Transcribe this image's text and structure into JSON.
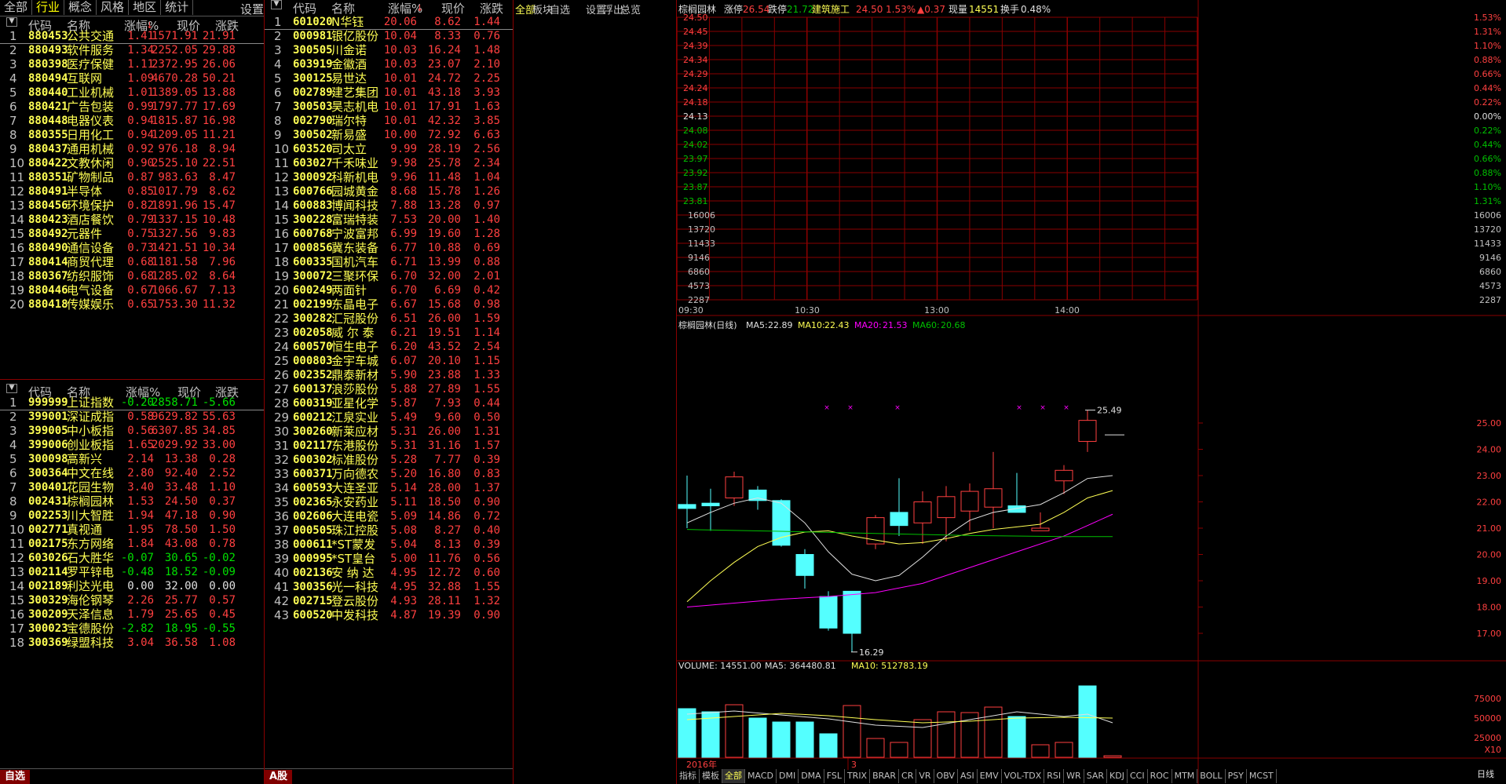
{
  "left_tabs": [
    "全部",
    "行业",
    "概念",
    "风格",
    "地区",
    "统计"
  ],
  "left_tabs_active": 1,
  "left_settings": "设置",
  "sector_table": {
    "headers": [
      "代码",
      "名称",
      "涨幅%",
      "现价",
      "涨跌"
    ],
    "rows": [
      [
        "1",
        "880453",
        "公共交通",
        "1.41",
        "1571.91",
        "21.91"
      ],
      [
        "2",
        "880493",
        "软件服务",
        "1.34",
        "2252.05",
        "29.88"
      ],
      [
        "3",
        "880398",
        "医疗保健",
        "1.11",
        "2372.95",
        "26.06"
      ],
      [
        "4",
        "880494",
        "互联网",
        "1.09",
        "4670.28",
        "50.21"
      ],
      [
        "5",
        "880440",
        "工业机械",
        "1.01",
        "1389.05",
        "13.88"
      ],
      [
        "6",
        "880421",
        "广告包装",
        "0.99",
        "1797.77",
        "17.69"
      ],
      [
        "7",
        "880448",
        "电器仪表",
        "0.94",
        "1815.87",
        "16.98"
      ],
      [
        "8",
        "880355",
        "日用化工",
        "0.94",
        "1209.05",
        "11.21"
      ],
      [
        "9",
        "880437",
        "通用机械",
        "0.92",
        "976.18",
        "8.94"
      ],
      [
        "10",
        "880422",
        "文教休闲",
        "0.90",
        "2525.10",
        "22.51"
      ],
      [
        "11",
        "880351",
        "矿物制品",
        "0.87",
        "983.63",
        "8.47"
      ],
      [
        "12",
        "880491",
        "半导体",
        "0.85",
        "1017.79",
        "8.62"
      ],
      [
        "13",
        "880456",
        "环境保护",
        "0.82",
        "1891.96",
        "15.47"
      ],
      [
        "14",
        "880423",
        "酒店餐饮",
        "0.79",
        "1337.15",
        "10.48"
      ],
      [
        "15",
        "880492",
        "元器件",
        "0.75",
        "1327.56",
        "9.83"
      ],
      [
        "16",
        "880490",
        "通信设备",
        "0.73",
        "1421.51",
        "10.34"
      ],
      [
        "17",
        "880414",
        "商贸代理",
        "0.68",
        "1181.58",
        "7.96"
      ],
      [
        "18",
        "880367",
        "纺织服饰",
        "0.68",
        "1285.02",
        "8.64"
      ],
      [
        "19",
        "880446",
        "电气设备",
        "0.67",
        "1066.67",
        "7.13"
      ],
      [
        "20",
        "880418",
        "传媒娱乐",
        "0.65",
        "1753.30",
        "11.32"
      ]
    ]
  },
  "watch_table": {
    "headers": [
      "代码",
      "名称",
      "涨幅%",
      "现价",
      "涨跌"
    ],
    "rows": [
      [
        "1",
        "999999",
        "上证指数",
        "-0.20",
        "2858.71",
        "-5.66"
      ],
      [
        "2",
        "399001",
        "深证成指",
        "0.58",
        "9629.82",
        "55.63"
      ],
      [
        "3",
        "399005",
        "中小板指",
        "0.56",
        "6307.85",
        "34.85"
      ],
      [
        "4",
        "399006",
        "创业板指",
        "1.65",
        "2029.92",
        "33.00"
      ],
      [
        "5",
        "300098",
        "高新兴",
        "2.14",
        "13.38",
        "0.28"
      ],
      [
        "6",
        "300364",
        "中文在线",
        "2.80",
        "92.40",
        "2.52"
      ],
      [
        "7",
        "300401",
        "花园生物",
        "3.40",
        "33.48",
        "1.10"
      ],
      [
        "8",
        "002431",
        "棕榈园林",
        "1.53",
        "24.50",
        "0.37"
      ],
      [
        "9",
        "002253",
        "川大智胜",
        "1.94",
        "47.18",
        "0.90"
      ],
      [
        "10",
        "002771",
        "真视通",
        "1.95",
        "78.50",
        "1.50"
      ],
      [
        "11",
        "002175",
        "东方网络",
        "1.84",
        "43.08",
        "0.78"
      ],
      [
        "12",
        "603026",
        "石大胜华",
        "-0.07",
        "30.65",
        "-0.02"
      ],
      [
        "13",
        "002114",
        "罗平锌电",
        "-0.48",
        "18.52",
        "-0.09"
      ],
      [
        "14",
        "002189",
        "利达光电",
        "0.00",
        "32.00",
        "0.00"
      ],
      [
        "15",
        "300329",
        "海伦钢琴",
        "2.26",
        "25.77",
        "0.57"
      ],
      [
        "16",
        "300209",
        "天泽信息",
        "1.79",
        "25.65",
        "0.45"
      ],
      [
        "17",
        "300023",
        "宝德股份",
        "-2.82",
        "18.95",
        "-0.55"
      ],
      [
        "18",
        "300369",
        "绿盟科技",
        "3.04",
        "36.58",
        "1.08"
      ]
    ]
  },
  "left_bottom_tab": "自选",
  "stock_table": {
    "headers": [
      "代码",
      "名称",
      "涨幅%",
      "现价",
      "涨跌"
    ],
    "rows": [
      [
        "1",
        "601020",
        "N华钰",
        "20.06",
        "8.62",
        "1.44"
      ],
      [
        "2",
        "000981",
        "银亿股份",
        "10.04",
        "8.33",
        "0.76"
      ],
      [
        "3",
        "300505",
        "川金诺",
        "10.03",
        "16.24",
        "1.48"
      ],
      [
        "4",
        "603919",
        "金徽酒",
        "10.03",
        "23.07",
        "2.10"
      ],
      [
        "5",
        "300125",
        "易世达",
        "10.01",
        "24.72",
        "2.25"
      ],
      [
        "6",
        "002789",
        "建艺集团",
        "10.01",
        "43.18",
        "3.93"
      ],
      [
        "7",
        "300503",
        "昊志机电",
        "10.01",
        "17.91",
        "1.63"
      ],
      [
        "8",
        "002790",
        "瑞尔特",
        "10.01",
        "42.32",
        "3.85"
      ],
      [
        "9",
        "300502",
        "新易盛",
        "10.00",
        "72.92",
        "6.63"
      ],
      [
        "10",
        "603520",
        "司太立",
        "9.99",
        "28.19",
        "2.56"
      ],
      [
        "11",
        "603027",
        "千禾味业",
        "9.98",
        "25.78",
        "2.34"
      ],
      [
        "12",
        "300092",
        "科新机电",
        "9.96",
        "11.48",
        "1.04"
      ],
      [
        "13",
        "600766",
        "园城黄金",
        "8.68",
        "15.78",
        "1.26"
      ],
      [
        "14",
        "600883",
        "博闻科技",
        "7.88",
        "13.28",
        "0.97"
      ],
      [
        "15",
        "300228",
        "富瑞特装",
        "7.53",
        "20.00",
        "1.40"
      ],
      [
        "16",
        "600768",
        "宁波富邦",
        "6.99",
        "19.60",
        "1.28"
      ],
      [
        "17",
        "000856",
        "冀东装备",
        "6.77",
        "10.88",
        "0.69"
      ],
      [
        "18",
        "600335",
        "国机汽车",
        "6.71",
        "13.99",
        "0.88"
      ],
      [
        "19",
        "300072",
        "三聚环保",
        "6.70",
        "32.00",
        "2.01"
      ],
      [
        "20",
        "600249",
        "两面针",
        "6.70",
        "6.69",
        "0.42"
      ],
      [
        "21",
        "002199",
        "东晶电子",
        "6.67",
        "15.68",
        "0.98"
      ],
      [
        "22",
        "300282",
        "汇冠股份",
        "6.51",
        "26.00",
        "1.59"
      ],
      [
        "23",
        "002058",
        "威 尔 泰",
        "6.21",
        "19.51",
        "1.14"
      ],
      [
        "24",
        "600570",
        "恒生电子",
        "6.20",
        "43.52",
        "2.54"
      ],
      [
        "25",
        "000803",
        "金宇车城",
        "6.07",
        "20.10",
        "1.15"
      ],
      [
        "26",
        "002352",
        "鼎泰新材",
        "5.90",
        "23.88",
        "1.33"
      ],
      [
        "27",
        "600137",
        "浪莎股份",
        "5.88",
        "27.89",
        "1.55"
      ],
      [
        "28",
        "600319",
        "亚星化学",
        "5.87",
        "7.93",
        "0.44"
      ],
      [
        "29",
        "600212",
        "江泉实业",
        "5.49",
        "9.60",
        "0.50"
      ],
      [
        "30",
        "300260",
        "新莱应材",
        "5.31",
        "26.00",
        "1.31"
      ],
      [
        "31",
        "002117",
        "东港股份",
        "5.31",
        "31.16",
        "1.57"
      ],
      [
        "32",
        "600302",
        "标准股份",
        "5.28",
        "7.77",
        "0.39"
      ],
      [
        "33",
        "600371",
        "万向德农",
        "5.20",
        "16.80",
        "0.83"
      ],
      [
        "34",
        "600593",
        "大连圣亚",
        "5.14",
        "28.00",
        "1.37"
      ],
      [
        "35",
        "002365",
        "永安药业",
        "5.11",
        "18.50",
        "0.90"
      ],
      [
        "36",
        "002606",
        "大连电瓷",
        "5.09",
        "14.86",
        "0.72"
      ],
      [
        "37",
        "000505",
        "珠江控股",
        "5.08",
        "8.27",
        "0.40"
      ],
      [
        "38",
        "000611",
        "*ST蒙发",
        "5.04",
        "8.13",
        "0.39"
      ],
      [
        "39",
        "000995",
        "*ST皇台",
        "5.00",
        "11.76",
        "0.56"
      ],
      [
        "40",
        "002136",
        "安 纳 达",
        "4.95",
        "12.72",
        "0.60"
      ],
      [
        "41",
        "300356",
        "光一科技",
        "4.95",
        "32.88",
        "1.55"
      ],
      [
        "42",
        "002715",
        "登云股份",
        "4.93",
        "28.11",
        "1.32"
      ],
      [
        "43",
        "600520",
        "中发科技",
        "4.87",
        "19.39",
        "0.90"
      ]
    ]
  },
  "mid_bottom_tab": "A股",
  "news_menu": [
    "全部",
    "板块",
    "自选",
    "设置",
    "浮出",
    "总览"
  ],
  "intraday": {
    "stock_name": "棕榈园林",
    "limit_up_label": "涨停",
    "limit_up": "26.54",
    "limit_down_label": "跌停",
    "limit_down": "21.72",
    "industry": "建筑施工",
    "price": "24.50",
    "pct": "1.53%",
    "change": "▲0.37",
    "volume_label": "现量",
    "volume": "14551",
    "turnover_label": "换手",
    "turnover": "0.48%",
    "left_axis": [
      "24.50",
      "24.45",
      "24.39",
      "24.34",
      "24.29",
      "24.24",
      "24.18",
      "24.13",
      "24.08",
      "24.02",
      "23.97",
      "23.92",
      "23.87",
      "23.81"
    ],
    "right_axis": [
      "1.53%",
      "1.31%",
      "1.10%",
      "0.88%",
      "0.66%",
      "0.44%",
      "0.22%",
      "0.00%",
      "0.22%",
      "0.44%",
      "0.66%",
      "0.88%",
      "1.10%",
      "1.31%"
    ],
    "vol_axis": [
      "16006",
      "13720",
      "11433",
      "9146",
      "6860",
      "4573",
      "2287"
    ],
    "time_axis": [
      "09:30",
      "10:30",
      "13:00",
      "14:00"
    ]
  },
  "daily": {
    "title": "棕榈园林(日线)",
    "ma5_label": "MA5:",
    "ma5": "22.89",
    "ma10_label": "MA10:",
    "ma10": "22.43",
    "ma20_label": "MA20:",
    "ma20": "21.53",
    "ma60_label": "MA60:",
    "ma60": "20.68",
    "right_axis": [
      "25.00",
      "24.00",
      "23.00",
      "22.00",
      "21.00",
      "20.00",
      "19.00",
      "18.00",
      "17.00"
    ],
    "high_label": "25.49",
    "low_label": "16.29",
    "volume_line": "VOLUME: 14551.00",
    "vol_ma5": "MA5: 364480.81",
    "vol_ma10": "MA10: 512783.19",
    "vol_axis": [
      "75000",
      "50000",
      "25000"
    ],
    "vol_unit": "X10",
    "date_label": "2016年",
    "month_label": "3",
    "period": "日线"
  },
  "indicator_tabs": [
    "指标",
    "模板",
    "全部",
    "MACD",
    "DMI",
    "DMA",
    "FSL",
    "TRIX",
    "BRAR",
    "CR",
    "VR",
    "OBV",
    "ASI",
    "EMV",
    "VOL-TDX",
    "RSI",
    "WR",
    "SAR",
    "KDJ",
    "CCI",
    "ROC",
    "MTM",
    "BOLL",
    "PSY",
    "MCST"
  ],
  "indicator_active": 2,
  "colors": {
    "up": "#ff4040",
    "down": "#54ffff",
    "yellow": "#ffff54",
    "grid": "#8a0000",
    "ma20": "#ff00ff",
    "ma60": "#00c000"
  }
}
